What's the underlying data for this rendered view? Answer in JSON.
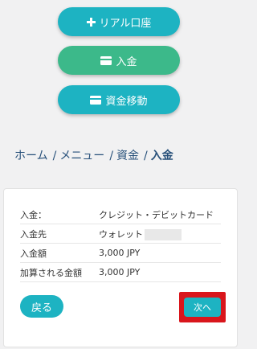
{
  "menu": {
    "real_account": "リアル口座",
    "deposit": "入金",
    "transfer": "資金移動"
  },
  "breadcrumb": {
    "home": "ホーム",
    "menu": "メニュー",
    "funds": "資金",
    "current": "入金",
    "separator": "/"
  },
  "confirm": {
    "rows": [
      {
        "label": "入金：",
        "value": "クレジット・デビットカード"
      },
      {
        "label": "入金先",
        "value": "ウォレット"
      },
      {
        "label": "入金額",
        "value": "3,000 JPY"
      },
      {
        "label": "加算される金額",
        "value": "3,000 JPY"
      }
    ],
    "back_label": "戻る",
    "next_label": "次へ"
  },
  "colors": {
    "teal": "#1db3c2",
    "green": "#3cb98a",
    "highlight": "#d9161c",
    "breadcrumb": "#27507a"
  }
}
